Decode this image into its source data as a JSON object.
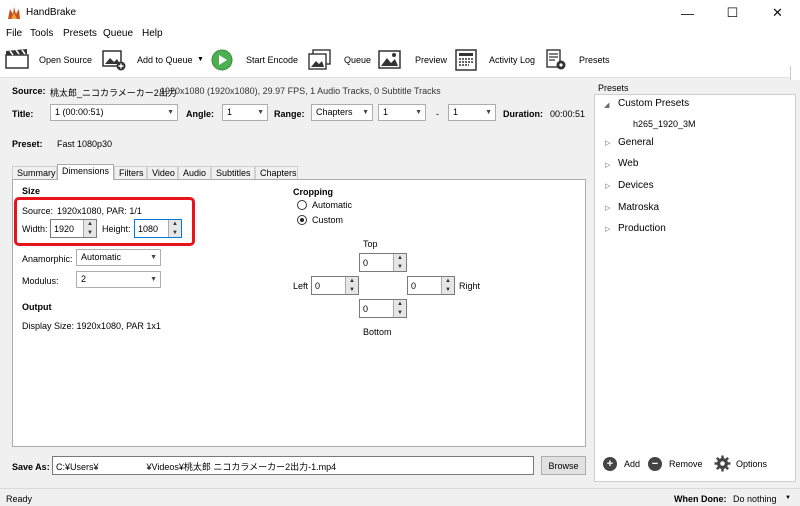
{
  "window": {
    "title": "HandBrake",
    "minimize_glyph": "—",
    "maximize_glyph": "☐",
    "close_glyph": "✕"
  },
  "menu": [
    "File",
    "Tools",
    "Presets",
    "Queue",
    "Help"
  ],
  "toolbar": {
    "open_source": "Open Source",
    "add_to_queue": "Add to Queue",
    "start_encode": "Start Encode",
    "queue": "Queue",
    "preview": "Preview",
    "activity_log": "Activity Log",
    "presets": "Presets"
  },
  "source": {
    "label": "Source:",
    "name": "桃太郎_ニコカラメーカー2出力",
    "info": "1920x1080 (1920x1080), 29.97 FPS, 1 Audio Tracks, 0 Subtitle Tracks"
  },
  "title_row": {
    "title_label": "Title:",
    "title_value": "1 (00:00:51)",
    "angle_label": "Angle:",
    "angle_value": "1",
    "range_label": "Range:",
    "range_type": "Chapters",
    "range_start": "1",
    "range_dash": "-",
    "range_end": "1",
    "duration_label": "Duration:",
    "duration_value": "00:00:51"
  },
  "preset_row": {
    "label": "Preset:",
    "value": "Fast 1080p30"
  },
  "tabs": [
    "Summary",
    "Dimensions",
    "Filters",
    "Video",
    "Audio",
    "Subtitles",
    "Chapters"
  ],
  "dimensions": {
    "size_heading": "Size",
    "source_label": "Source:",
    "source_value": "1920x1080, PAR: 1/1",
    "width_label": "Width:",
    "width_value": "1920",
    "height_label": "Height:",
    "height_value": "1080",
    "anamorphic_label": "Anamorphic:",
    "anamorphic_value": "Automatic",
    "modulus_label": "Modulus:",
    "modulus_value": "2",
    "output_heading": "Output",
    "display_size": "Display Size: 1920x1080,  PAR 1x1",
    "cropping_heading": "Cropping",
    "crop_automatic": "Automatic",
    "crop_custom": "Custom",
    "crop_mode": "Custom",
    "top_label": "Top",
    "top_value": "0",
    "left_label": "Left",
    "left_value": "0",
    "right_label": "Right",
    "right_value": "0",
    "bottom_label": "Bottom",
    "bottom_value": "0"
  },
  "save_as": {
    "label": "Save As:",
    "path_start": "C:¥Users¥",
    "path_end": "¥Videos¥桃太郎 ニコカラメーカー2出力-1.mp4",
    "browse": "Browse"
  },
  "presets_panel": {
    "heading": "Presets",
    "custom_presets": "Custom Presets",
    "custom_child": "h265_1920_3M",
    "groups": [
      "General",
      "Web",
      "Devices",
      "Matroska",
      "Production"
    ],
    "add": "Add",
    "remove": "Remove",
    "options": "Options"
  },
  "status": {
    "left": "Ready",
    "when_done_label": "When Done:",
    "when_done_value": "Do nothing"
  },
  "colors": {
    "highlight_border": "#e8141b",
    "start_green": "#4caf50",
    "selection_blue": "#cce4f7"
  }
}
